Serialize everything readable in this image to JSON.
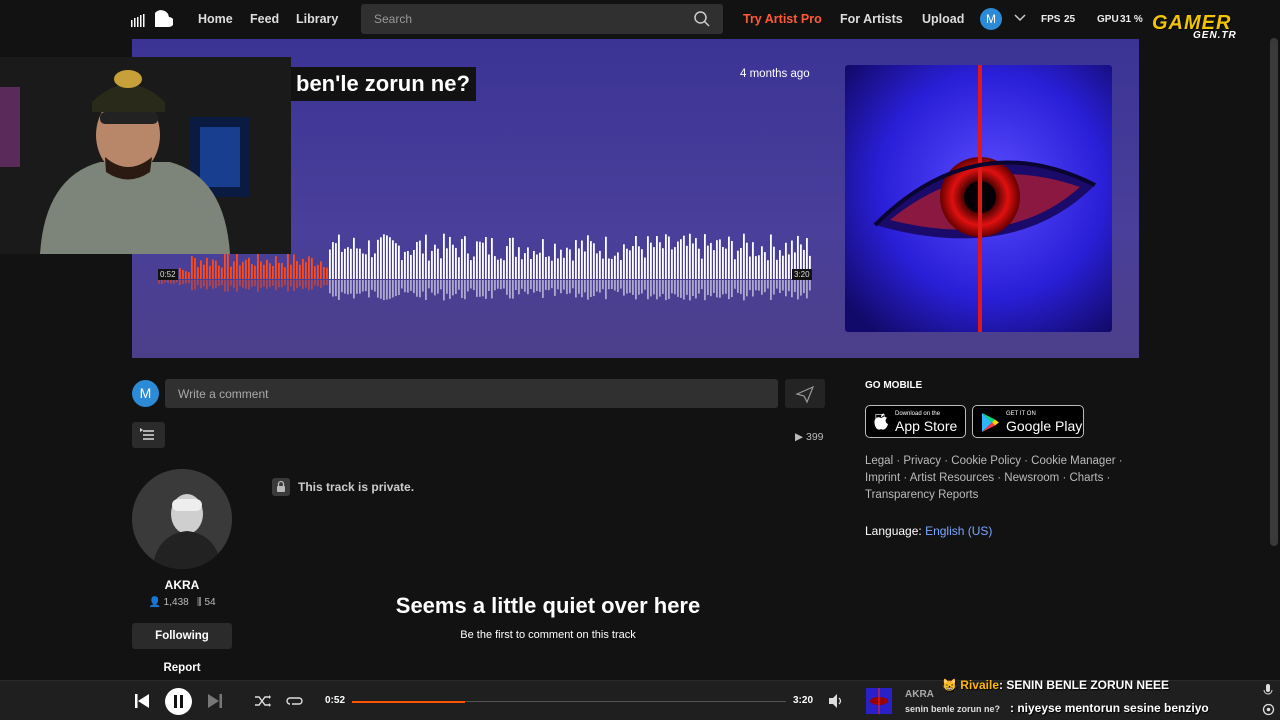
{
  "nav": {
    "home": "Home",
    "feed": "Feed",
    "library": "Library",
    "search_placeholder": "Search",
    "try_artist_pro": "Try Artist Pro",
    "for_artists": "For Artists",
    "upload": "Upload",
    "avatar_letter": "M"
  },
  "overlay": {
    "fps_label": "FPS",
    "fps_value": "25",
    "gpu_label": "GPU",
    "gpu_value": "31 %",
    "brand": "GAMER",
    "brand_sub": "GEN.TR"
  },
  "track": {
    "title": "ben'le zorun ne?",
    "posted": "4 months ago",
    "elapsed": "0:52",
    "duration": "3:20",
    "progress": 0.26
  },
  "comment": {
    "avatar_letter": "M",
    "placeholder": "Write a comment",
    "plays": "399"
  },
  "artist": {
    "name": "AKRA",
    "followers": "1,438",
    "tracks": "54",
    "follow_label": "Following",
    "report_label": "Report"
  },
  "main": {
    "private_note": "This track is private.",
    "quiet_title": "Seems a little quiet over here",
    "quiet_sub": "Be the first to comment on this track"
  },
  "sidebar": {
    "go_mobile": "GO MOBILE",
    "app_store_small": "Download on the",
    "app_store_big": "App Store",
    "google_small": "GET IT ON",
    "google_big": "Google Play",
    "links_line1": "Legal · Privacy · Cookie Policy · Cookie Manager ·",
    "links_line2": "Imprint · Artist Resources · Newsroom · Charts ·",
    "links_line3": "Transparency Reports",
    "language_label": "Language:",
    "language_value": "English (US)"
  },
  "player": {
    "position": "0:52",
    "duration": "3:20",
    "progress": 0.26,
    "artist": "AKRA",
    "title": "senin benle zorun ne?"
  },
  "chat": [
    {
      "user": "Rivaile",
      "text": ": SENIN BENLE ZORUN NEEE"
    },
    {
      "user": "",
      "text": ": niyeyse mentorun sesine benziyo"
    }
  ],
  "colors": {
    "accent": "#ff5500",
    "hero_bg": "#3b3495"
  }
}
